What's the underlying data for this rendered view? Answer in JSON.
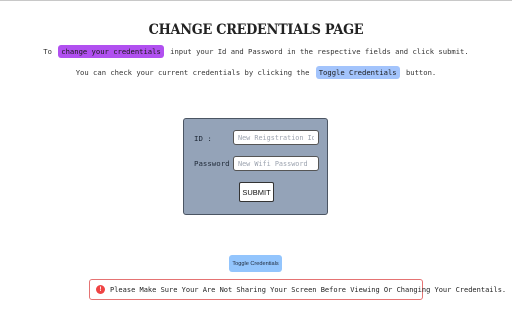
{
  "page": {
    "title": "CHANGE CREDENTIALS PAGE",
    "instruction": {
      "prefix": "To",
      "highlight": "change your credentials",
      "suffix": "input your Id and Password in the respective fields and click submit."
    },
    "toggle_info": {
      "prefix": "You can check your current credentials by clicking the",
      "highlight": "Toggle Credentials",
      "suffix": "button."
    }
  },
  "form": {
    "id_label": "ID :",
    "id_placeholder": "New Reigstration Id",
    "id_value": "",
    "password_label": "Password :",
    "password_placeholder": "New Wifi Password",
    "password_value": "",
    "submit_label": "SUBMIT"
  },
  "toggle_button": {
    "label": "Toggle Credentials"
  },
  "warning": {
    "icon": "!",
    "text": "Please Make Sure Your Are Not Sharing Your Screen Before Viewing Or Changing Your Credentails."
  },
  "colors": {
    "highlight_purple": "#b150f0",
    "highlight_blue": "#a3c4fc",
    "panel_bg": "#94a3b8",
    "toggle_bg": "#93c5fd",
    "warning_border": "#e57373",
    "warning_icon": "#ef4444"
  }
}
